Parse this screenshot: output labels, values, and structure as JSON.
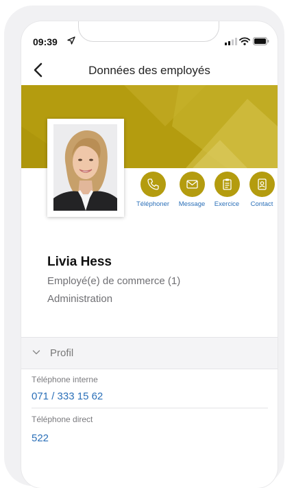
{
  "status": {
    "time": "09:39"
  },
  "nav": {
    "title": "Données des employés"
  },
  "actions": [
    {
      "label": "Téléphoner",
      "icon": "phone-icon"
    },
    {
      "label": "Message",
      "icon": "mail-icon"
    },
    {
      "label": "Exercice",
      "icon": "clipboard-icon"
    },
    {
      "label": "Contact",
      "icon": "contact-card-icon"
    }
  ],
  "employee": {
    "name": "Livia Hess",
    "role": "Employé(e) de commerce (1)",
    "department": "Administration"
  },
  "profile": {
    "section_label": "Profil",
    "fields": [
      {
        "label": "Téléphone interne",
        "value": "071 / 333 15 62"
      },
      {
        "label": "Téléphone direct",
        "value": "522"
      }
    ]
  },
  "colors": {
    "accent": "#b49c0f",
    "link": "#2a6fb8"
  }
}
